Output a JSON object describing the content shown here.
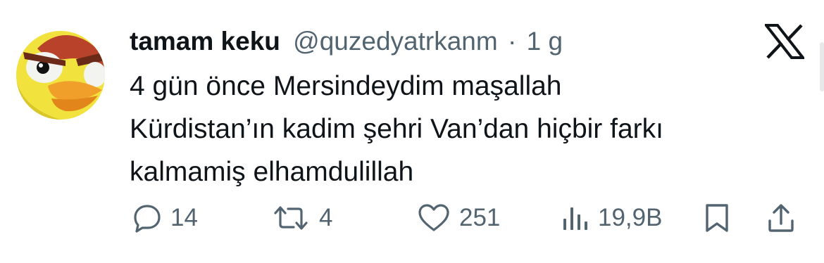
{
  "tweet": {
    "author": {
      "display_name": "tamam keku",
      "handle": "@quzedyatrkanm",
      "separator": "·",
      "time": "1 g",
      "avatar_icon": "angry-bird-avatar"
    },
    "platform_icon": "x-logo-icon",
    "text_lines": [
      "4 gün önce Mersindeydim maşallah",
      "Kürdistan’ın kadim şehri Van’dan hiçbir farkı",
      "kalmamiş elhamdulillah"
    ],
    "actions": {
      "reply": {
        "icon": "reply-icon",
        "count": "14"
      },
      "retweet": {
        "icon": "retweet-icon",
        "count": "4"
      },
      "like": {
        "icon": "heart-icon",
        "count": "251"
      },
      "views": {
        "icon": "views-icon",
        "count": "19,9B"
      },
      "bookmark": {
        "icon": "bookmark-icon"
      },
      "share": {
        "icon": "share-icon"
      }
    },
    "colors": {
      "text": "#0f1419",
      "secondary": "#536471",
      "background": "#ffffff"
    }
  }
}
